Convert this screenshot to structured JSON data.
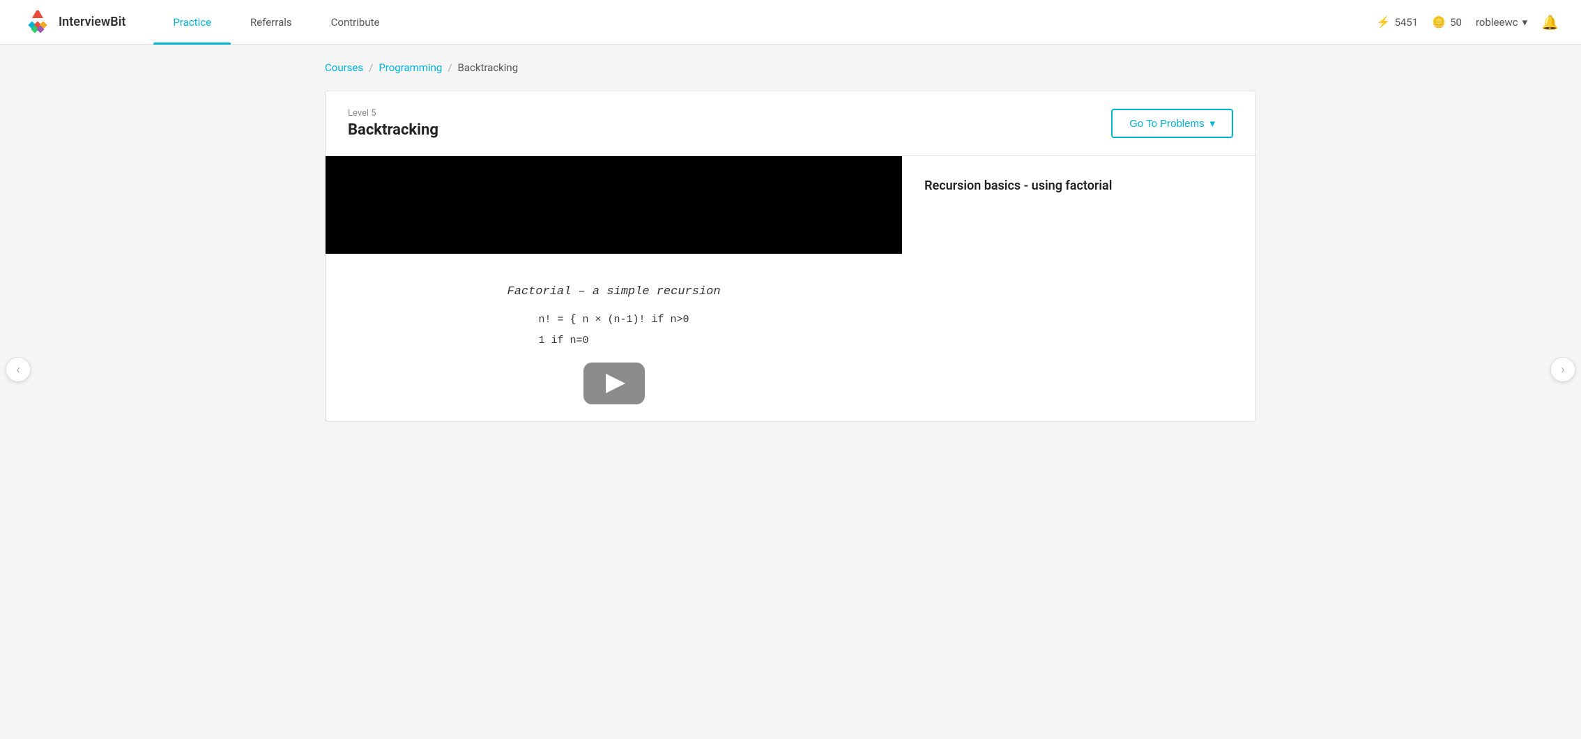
{
  "header": {
    "logo_text": "InterviewBit",
    "nav_items": [
      {
        "label": "Practice",
        "active": true
      },
      {
        "label": "Referrals",
        "active": false
      },
      {
        "label": "Contribute",
        "active": false
      }
    ],
    "stats": {
      "bolt_value": "5451",
      "coin_value": "50"
    },
    "user": {
      "name": "robleewc",
      "dropdown_arrow": "▾"
    },
    "bell_label": "notifications"
  },
  "breadcrumb": {
    "items": [
      {
        "label": "Courses",
        "link": true
      },
      {
        "label": "Programming",
        "link": true
      },
      {
        "label": "Backtracking",
        "link": false
      }
    ],
    "separator": "/"
  },
  "content": {
    "level": "Level 5",
    "title": "Backtracking",
    "go_to_problems_label": "Go To Problems",
    "dropdown_arrow": "▾"
  },
  "video": {
    "whiteboard_heading": "Factorial – a simple recursion",
    "whiteboard_formula_line1": "n! = { n × (n-1)!   if n>0",
    "whiteboard_formula_line2": "       1             if n=0",
    "play_button_aria": "play video",
    "title": "Recursion basics - using factorial"
  },
  "nav_arrows": {
    "left": "‹",
    "right": "›"
  }
}
